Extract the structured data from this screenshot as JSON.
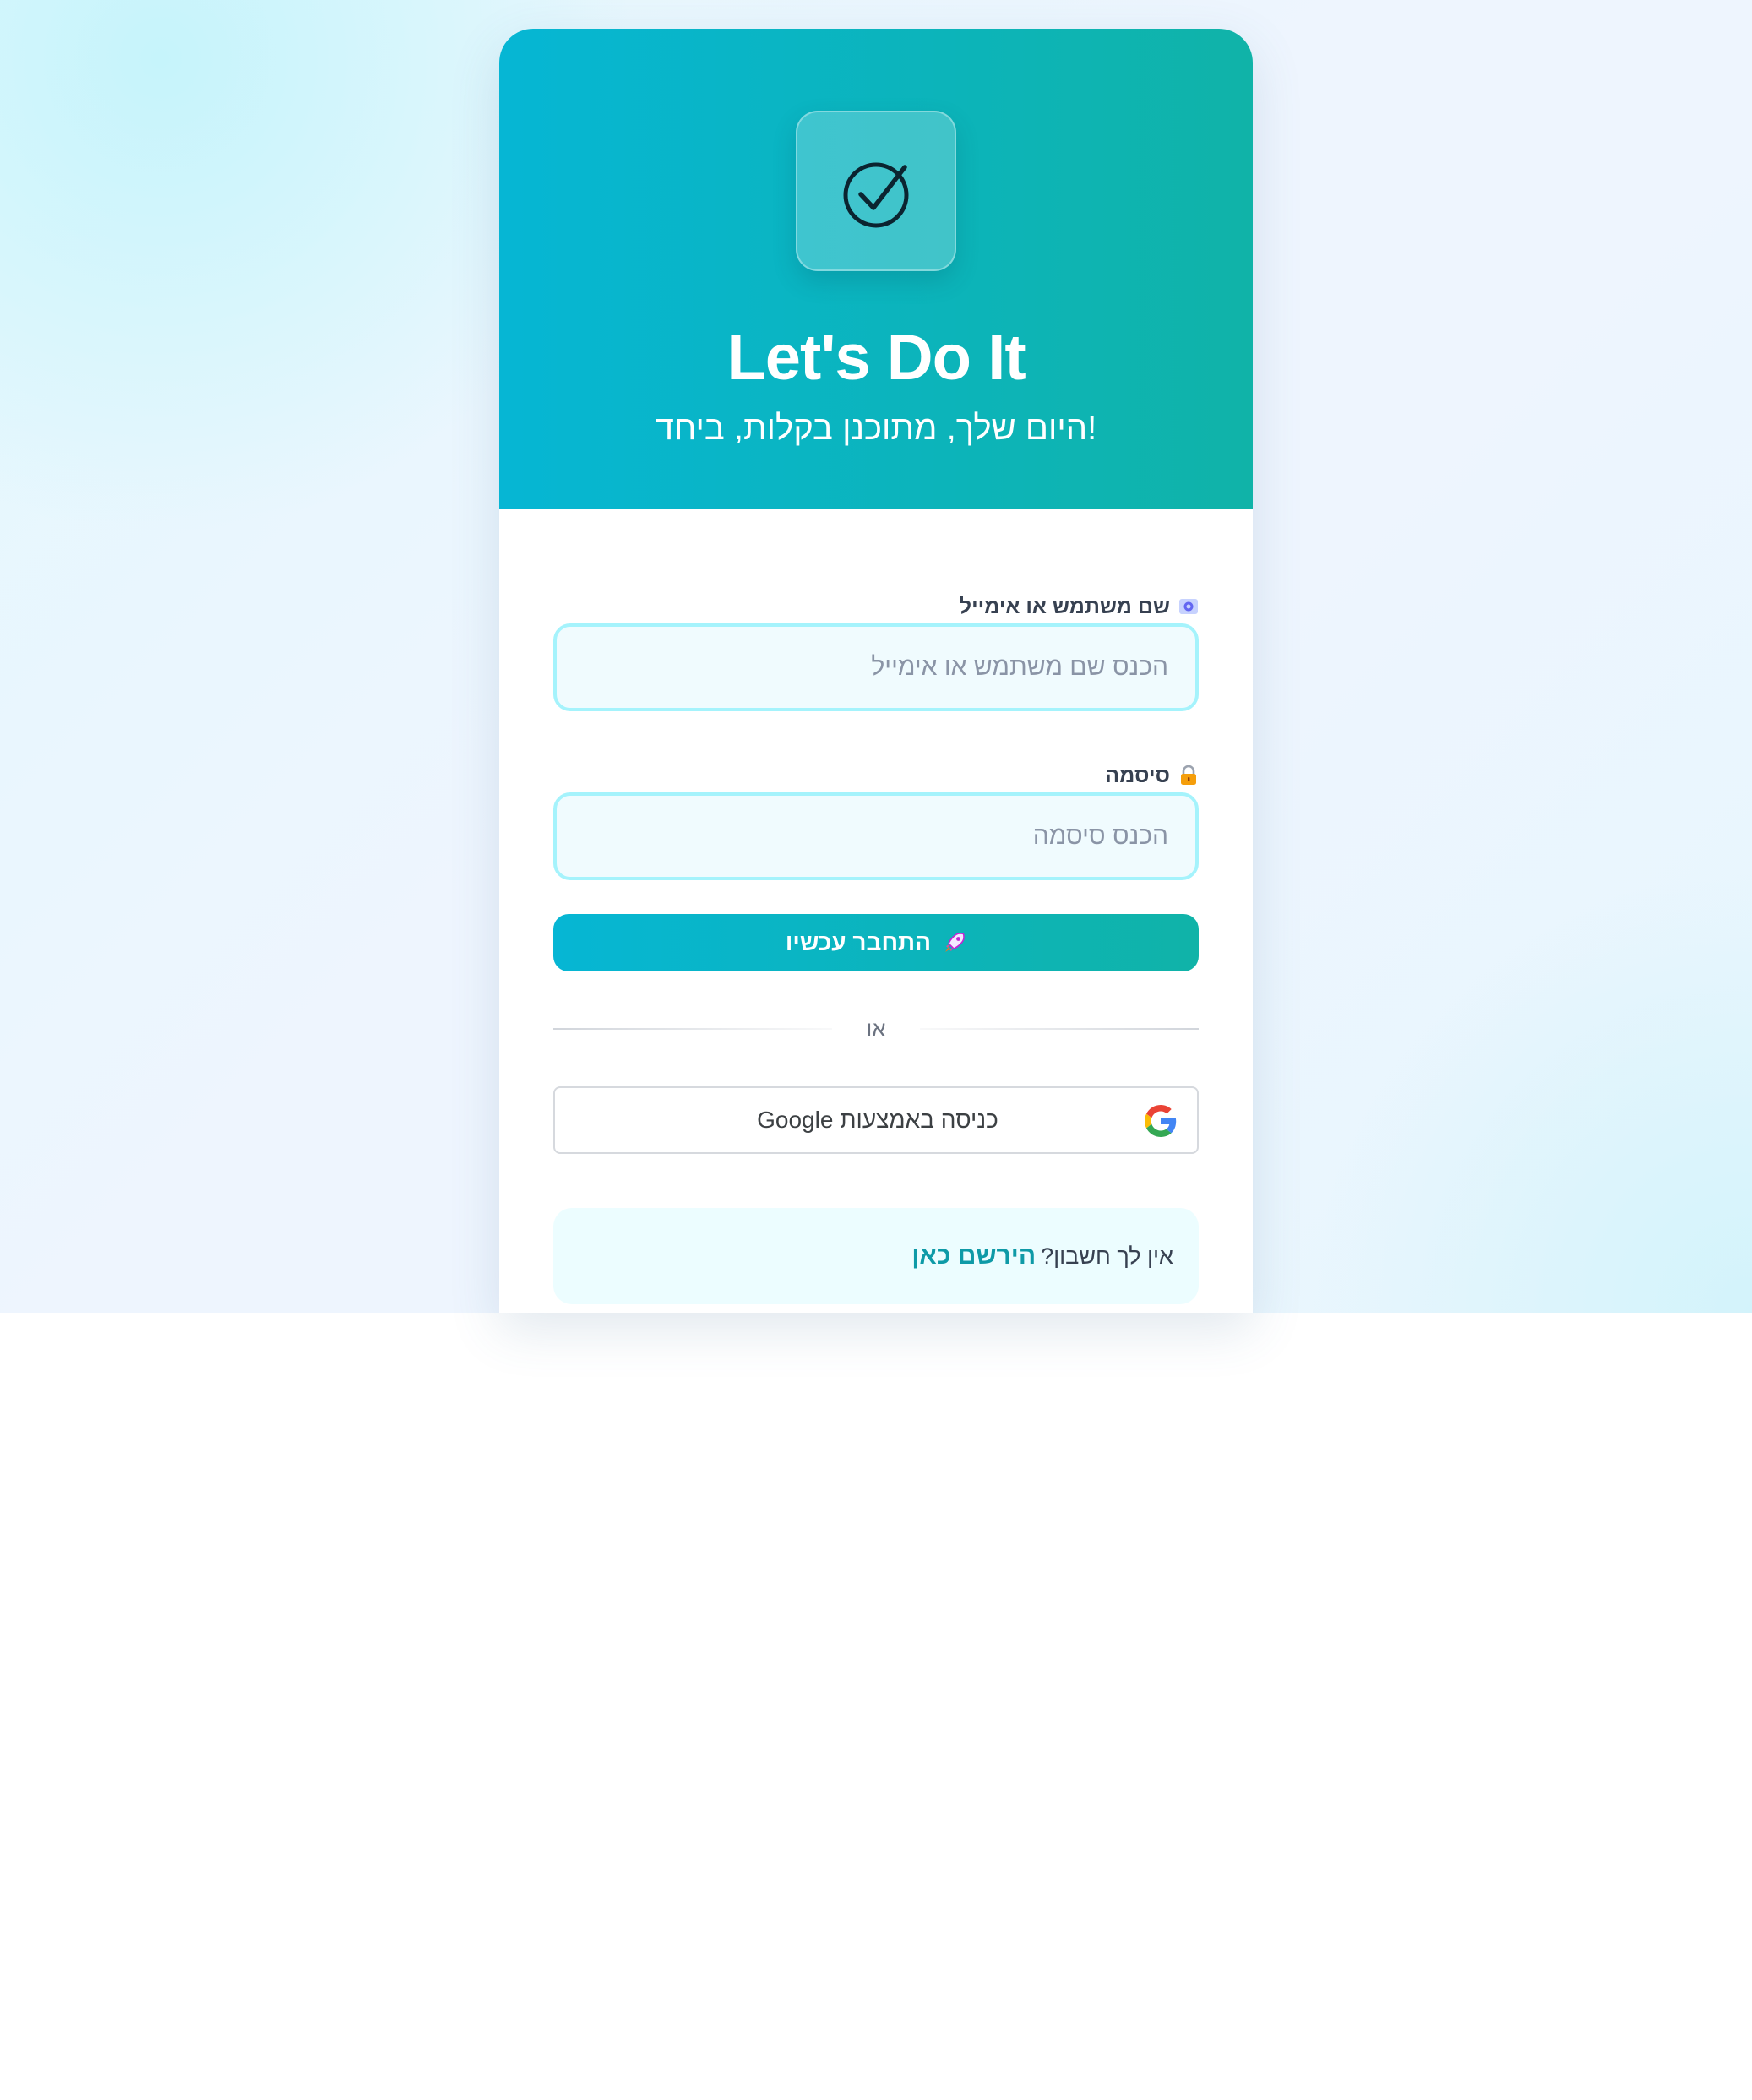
{
  "header": {
    "app_title": "Let's Do It",
    "app_subtitle": "היום שלך, מתוכנן בקלות, ביחד!",
    "logo_icon": "check-circle-icon"
  },
  "form": {
    "username": {
      "label": "שם משתמש או אימייל",
      "icon": "user-id-emoji-icon",
      "placeholder": "הכנס שם משתמש או אימייל",
      "value": ""
    },
    "password": {
      "label": "סיסמה",
      "icon": "lock-emoji-icon",
      "placeholder": "הכנס סיסמה",
      "value": ""
    },
    "submit": {
      "label": "התחבר עכשיו",
      "icon": "rocket-emoji-icon"
    },
    "divider_text": "או",
    "google": {
      "label": "כניסה באמצעות Google",
      "icon": "google-g-icon"
    },
    "register": {
      "prompt": "אין לך חשבון?",
      "link_label": "הירשם כאן"
    }
  },
  "colors": {
    "header_gradient_start": "#06b6d4",
    "header_gradient_end": "#10b3a8",
    "input_border": "#a5f3fc",
    "link": "#0e9aa7"
  }
}
